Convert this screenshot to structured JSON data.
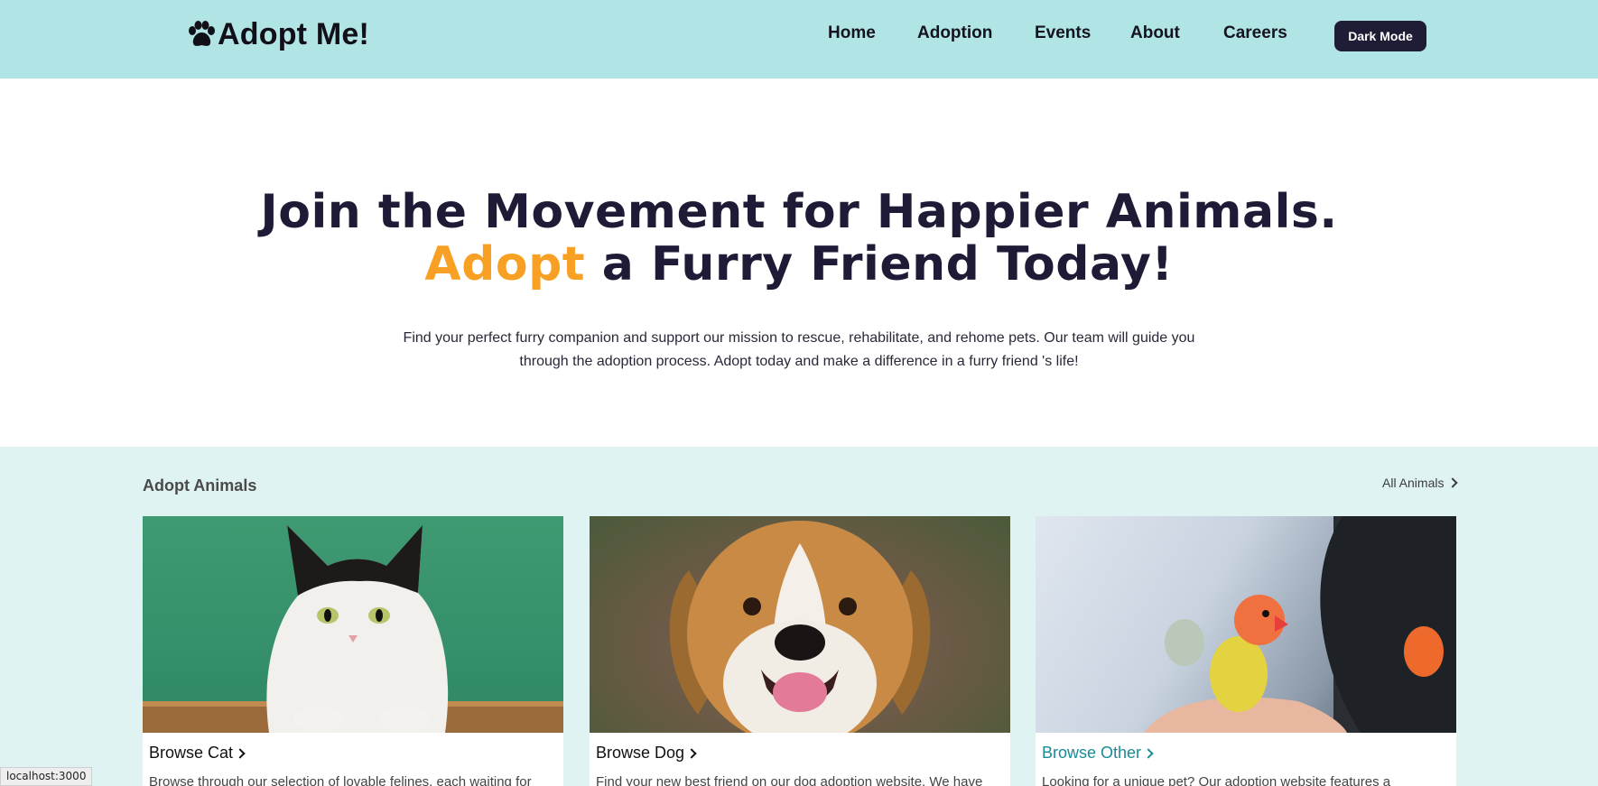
{
  "brand": {
    "name": "Adopt Me!",
    "icon": "paw-icon"
  },
  "nav": {
    "items": [
      {
        "label": "Home"
      },
      {
        "label": "Adoption"
      },
      {
        "label": "Events"
      },
      {
        "label": "About"
      },
      {
        "label": "Careers"
      }
    ],
    "dark_mode_label": "Dark Mode"
  },
  "hero": {
    "title_line1": "Join the Movement for Happier Animals.",
    "title_accent": "Adopt",
    "title_line2_rest": " a Furry Friend Today!",
    "description": "Find your perfect furry companion and support our mission to rescue, rehabilitate, and rehome pets. Our team will guide you through the adoption process. Adopt today and make a difference in a furry friend 's life!"
  },
  "adopt": {
    "title": "Adopt Animals",
    "all_link": "All Animals",
    "cards": [
      {
        "title": "Browse Cat",
        "desc": "Browse through our selection of lovable felines, each waiting for",
        "title_color": "#111111"
      },
      {
        "title": "Browse Dog",
        "desc": "Find your new best friend on our dog adoption website. We have",
        "title_color": "#111111"
      },
      {
        "title": "Browse Other",
        "desc": "Looking for a unique pet? Our adoption website features a",
        "title_color": "#1a8a96"
      }
    ]
  },
  "status_bar": {
    "text": "localhost:3000"
  },
  "colors": {
    "nav_bg": "#b1e4e4",
    "accent": "#f7a023",
    "heading": "#1f1b36",
    "section_bg": "#dff3f3",
    "button_bg": "#1f1c35"
  }
}
